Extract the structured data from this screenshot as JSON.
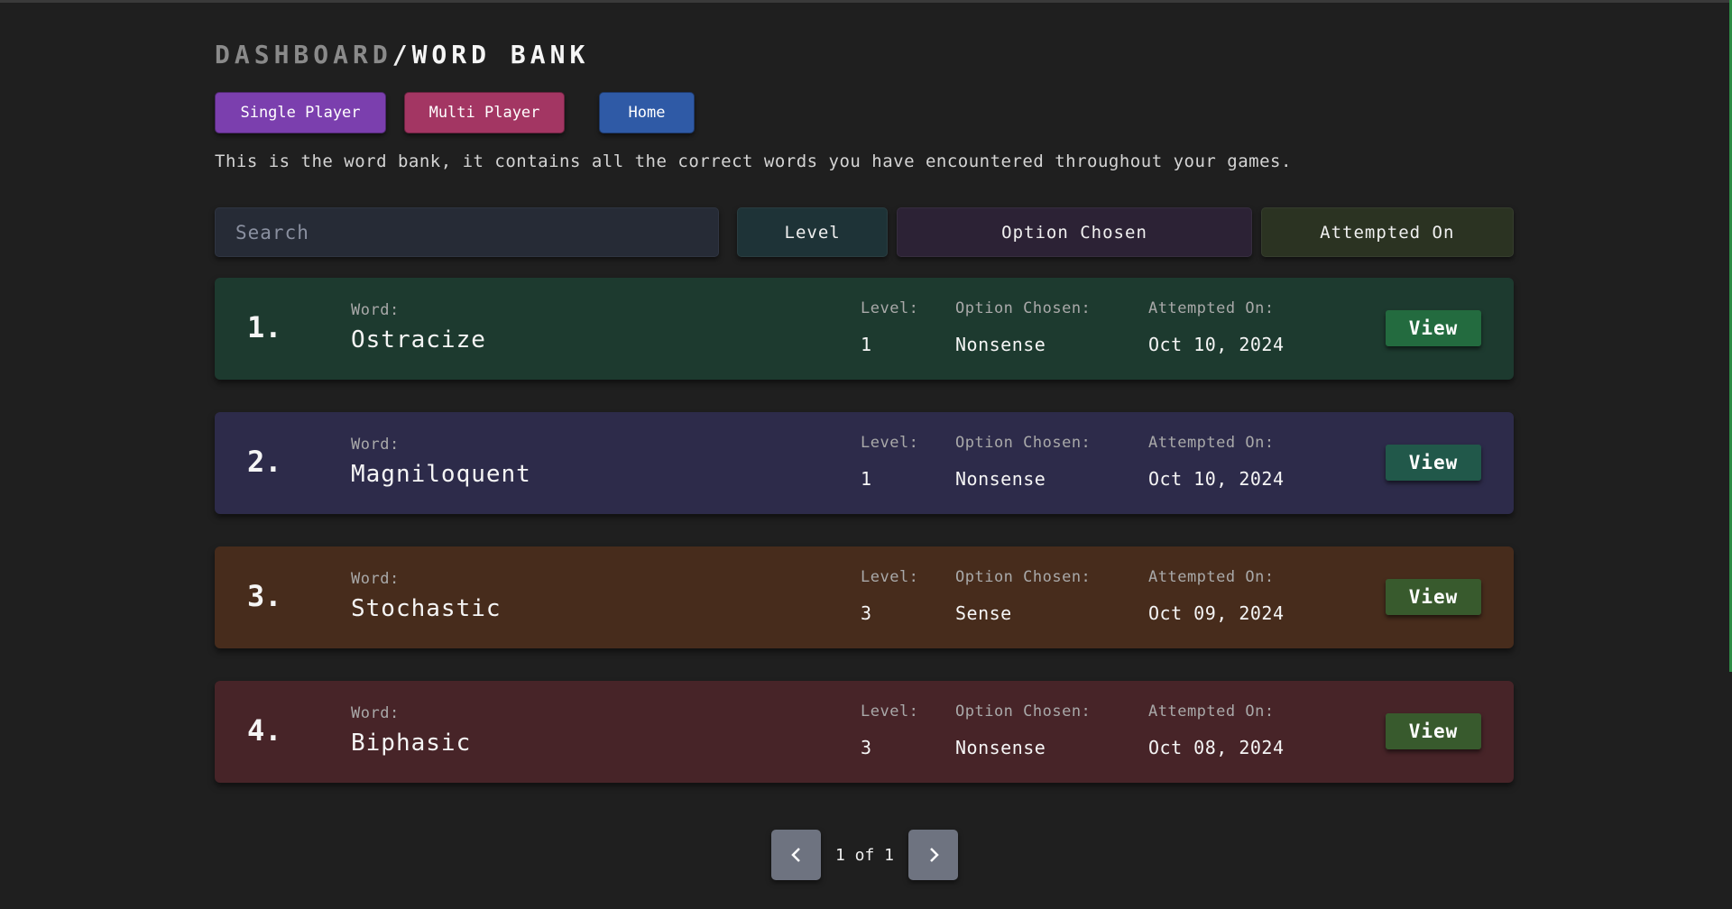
{
  "breadcrumb": {
    "parent": "DASHBOARD",
    "separator": "/",
    "current": "WORD BANK"
  },
  "nav": {
    "single": "Single Player",
    "multi": "Multi Player",
    "home": "Home"
  },
  "description": "This is the word bank, it contains all the correct words you have encountered throughout your games.",
  "filters": {
    "search_placeholder": "Search",
    "level": "Level",
    "option": "Option Chosen",
    "attempted": "Attempted On"
  },
  "labels": {
    "word": "Word:",
    "level": "Level:",
    "option": "Option Chosen:",
    "attempted": "Attempted On:",
    "view": "View"
  },
  "words": [
    {
      "index": "1.",
      "word": "Ostracize",
      "level": "1",
      "option": "Nonsense",
      "date": "Oct 10, 2024",
      "bg": "#1d3a2f",
      "btn": "#236b3f"
    },
    {
      "index": "2.",
      "word": "Magniloquent",
      "level": "1",
      "option": "Nonsense",
      "date": "Oct 10, 2024",
      "bg": "#2d2b4a",
      "btn": "#21584a"
    },
    {
      "index": "3.",
      "word": "Stochastic",
      "level": "3",
      "option": "Sense",
      "date": "Oct 09, 2024",
      "bg": "#472c1c",
      "btn": "#385a2d"
    },
    {
      "index": "4.",
      "word": "Biphasic",
      "level": "3",
      "option": "Nonsense",
      "date": "Oct 08, 2024",
      "bg": "#472428",
      "btn": "#385a2d"
    }
  ],
  "pagination": {
    "text": "1 of 1",
    "prev_icon": "chevron-left-icon",
    "next_icon": "chevron-right-icon"
  }
}
